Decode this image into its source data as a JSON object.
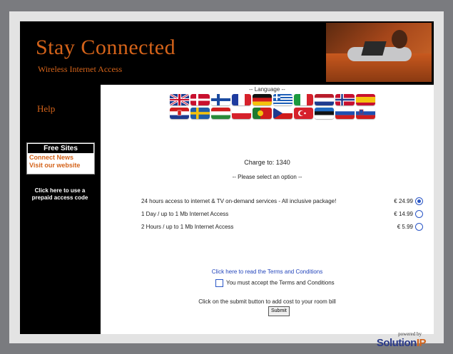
{
  "brand": {
    "title": "Stay Connected",
    "subtitle": "Wireless Internet Access"
  },
  "sidebar": {
    "help_label": "Help",
    "free_sites": {
      "header": "Free Sites",
      "links": [
        "Connect News",
        "Visit our website"
      ]
    },
    "prepaid_label": "Click here to use a prepaid access code"
  },
  "language": {
    "label": "-- Language --",
    "flags_row1": [
      "uk-flag-icon",
      "denmark-flag-icon",
      "finland-flag-icon",
      "france-flag-icon",
      "germany-flag-icon",
      "greece-flag-icon",
      "italy-flag-icon",
      "netherlands-flag-icon",
      "norway-flag-icon",
      "spain-flag-icon"
    ],
    "flags_row2": [
      "croatia-flag-icon",
      "sweden-flag-icon",
      "hungary-flag-icon",
      "poland-flag-icon",
      "portugal-flag-icon",
      "czech-flag-icon",
      "turkey-flag-icon",
      "estonia-flag-icon",
      "russia-flag-icon",
      "slovenia-flag-icon"
    ]
  },
  "charge_text": "Charge to: 1340",
  "select_option_text": "-- Please select an option --",
  "options": [
    {
      "desc": "24 hours access to internet & TV on-demand services - All inclusive package!",
      "price": "€ 24.99",
      "selected": true
    },
    {
      "desc": "1 Day / up to 1 Mb Internet Access",
      "price": "€ 14.99",
      "selected": false
    },
    {
      "desc": "2 Hours / up to 1 Mb Internet Access",
      "price": "€ 5.99",
      "selected": false
    }
  ],
  "terms_link": "Click here to read the Terms and Conditions",
  "accept_label": "You must accept the Terms and Conditions",
  "submit_text": "Click on the submit button to add cost to your room bill",
  "submit_label": "Submit",
  "powered_by": "powered by",
  "logo": {
    "main": "Solution",
    "accent": "IP"
  },
  "colors": {
    "brand_orange": "#d4631a",
    "link_blue": "#2244bb",
    "radio_blue": "#2a56c6"
  }
}
